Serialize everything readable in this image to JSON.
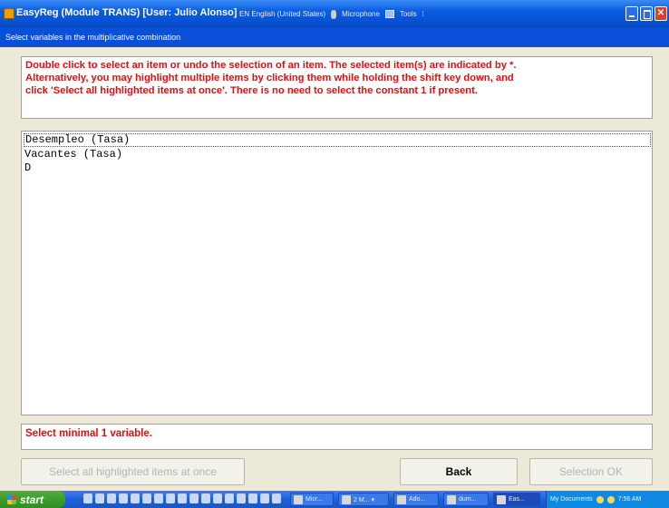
{
  "window": {
    "title": "EasyReg (Module TRANS) [User: Julio Alonso]",
    "subtitle": "Select variables in the multiplicative combination",
    "language_bar": {
      "language": "EN English (United States)",
      "microphone": "Microphone",
      "tools": "Tools"
    }
  },
  "instructions": {
    "lines": [
      "Double click to select an item or undo the selection of an item. The selected item(s) are indicated by *.",
      "Alternatively, you may highlight multiple items by clicking them while holding the shift key down, and",
      "click 'Select all highlighted items at once'. There is no need to select the constant 1 if present."
    ]
  },
  "variables": {
    "items": [
      "Desempleo (Tasa)",
      "Vacantes (Tasa)",
      "D"
    ],
    "focused_index": 0
  },
  "status": {
    "message": "Select minimal 1 variable."
  },
  "buttons": {
    "select_all": "Select all highlighted items at once",
    "back": "Back",
    "selection_ok": "Selection OK"
  },
  "taskbar": {
    "start": "start",
    "tasks": [
      "Micr...",
      "2 M... ▾",
      "Ado...",
      "dum...",
      "Eas..."
    ],
    "tray_text": "My Documents",
    "clock": "7:56 AM"
  },
  "colors": {
    "accent": "#0a4fd8",
    "warning_text": "#e01010",
    "taskbar": "#1f5fd8"
  }
}
